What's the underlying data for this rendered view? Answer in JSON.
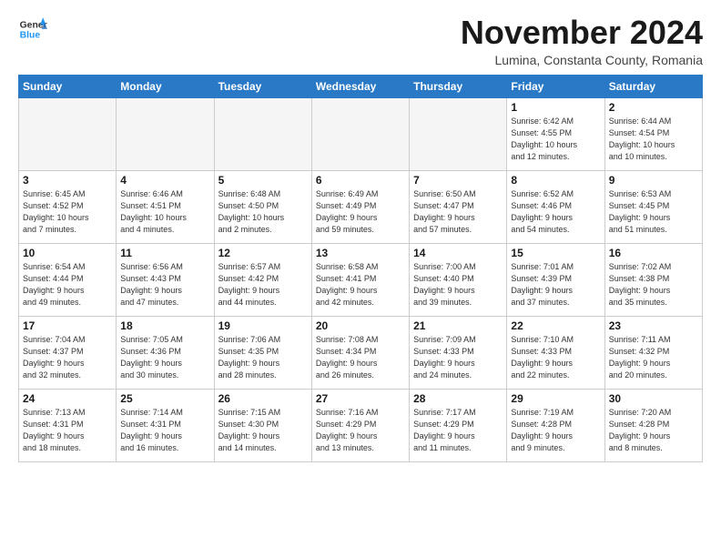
{
  "header": {
    "logo_line1": "General",
    "logo_line2": "Blue",
    "month_title": "November 2024",
    "subtitle": "Lumina, Constanta County, Romania"
  },
  "days_of_week": [
    "Sunday",
    "Monday",
    "Tuesday",
    "Wednesday",
    "Thursday",
    "Friday",
    "Saturday"
  ],
  "weeks": [
    [
      {
        "day": "",
        "info": ""
      },
      {
        "day": "",
        "info": ""
      },
      {
        "day": "",
        "info": ""
      },
      {
        "day": "",
        "info": ""
      },
      {
        "day": "",
        "info": ""
      },
      {
        "day": "1",
        "info": "Sunrise: 6:42 AM\nSunset: 4:55 PM\nDaylight: 10 hours\nand 12 minutes."
      },
      {
        "day": "2",
        "info": "Sunrise: 6:44 AM\nSunset: 4:54 PM\nDaylight: 10 hours\nand 10 minutes."
      }
    ],
    [
      {
        "day": "3",
        "info": "Sunrise: 6:45 AM\nSunset: 4:52 PM\nDaylight: 10 hours\nand 7 minutes."
      },
      {
        "day": "4",
        "info": "Sunrise: 6:46 AM\nSunset: 4:51 PM\nDaylight: 10 hours\nand 4 minutes."
      },
      {
        "day": "5",
        "info": "Sunrise: 6:48 AM\nSunset: 4:50 PM\nDaylight: 10 hours\nand 2 minutes."
      },
      {
        "day": "6",
        "info": "Sunrise: 6:49 AM\nSunset: 4:49 PM\nDaylight: 9 hours\nand 59 minutes."
      },
      {
        "day": "7",
        "info": "Sunrise: 6:50 AM\nSunset: 4:47 PM\nDaylight: 9 hours\nand 57 minutes."
      },
      {
        "day": "8",
        "info": "Sunrise: 6:52 AM\nSunset: 4:46 PM\nDaylight: 9 hours\nand 54 minutes."
      },
      {
        "day": "9",
        "info": "Sunrise: 6:53 AM\nSunset: 4:45 PM\nDaylight: 9 hours\nand 51 minutes."
      }
    ],
    [
      {
        "day": "10",
        "info": "Sunrise: 6:54 AM\nSunset: 4:44 PM\nDaylight: 9 hours\nand 49 minutes."
      },
      {
        "day": "11",
        "info": "Sunrise: 6:56 AM\nSunset: 4:43 PM\nDaylight: 9 hours\nand 47 minutes."
      },
      {
        "day": "12",
        "info": "Sunrise: 6:57 AM\nSunset: 4:42 PM\nDaylight: 9 hours\nand 44 minutes."
      },
      {
        "day": "13",
        "info": "Sunrise: 6:58 AM\nSunset: 4:41 PM\nDaylight: 9 hours\nand 42 minutes."
      },
      {
        "day": "14",
        "info": "Sunrise: 7:00 AM\nSunset: 4:40 PM\nDaylight: 9 hours\nand 39 minutes."
      },
      {
        "day": "15",
        "info": "Sunrise: 7:01 AM\nSunset: 4:39 PM\nDaylight: 9 hours\nand 37 minutes."
      },
      {
        "day": "16",
        "info": "Sunrise: 7:02 AM\nSunset: 4:38 PM\nDaylight: 9 hours\nand 35 minutes."
      }
    ],
    [
      {
        "day": "17",
        "info": "Sunrise: 7:04 AM\nSunset: 4:37 PM\nDaylight: 9 hours\nand 32 minutes."
      },
      {
        "day": "18",
        "info": "Sunrise: 7:05 AM\nSunset: 4:36 PM\nDaylight: 9 hours\nand 30 minutes."
      },
      {
        "day": "19",
        "info": "Sunrise: 7:06 AM\nSunset: 4:35 PM\nDaylight: 9 hours\nand 28 minutes."
      },
      {
        "day": "20",
        "info": "Sunrise: 7:08 AM\nSunset: 4:34 PM\nDaylight: 9 hours\nand 26 minutes."
      },
      {
        "day": "21",
        "info": "Sunrise: 7:09 AM\nSunset: 4:33 PM\nDaylight: 9 hours\nand 24 minutes."
      },
      {
        "day": "22",
        "info": "Sunrise: 7:10 AM\nSunset: 4:33 PM\nDaylight: 9 hours\nand 22 minutes."
      },
      {
        "day": "23",
        "info": "Sunrise: 7:11 AM\nSunset: 4:32 PM\nDaylight: 9 hours\nand 20 minutes."
      }
    ],
    [
      {
        "day": "24",
        "info": "Sunrise: 7:13 AM\nSunset: 4:31 PM\nDaylight: 9 hours\nand 18 minutes."
      },
      {
        "day": "25",
        "info": "Sunrise: 7:14 AM\nSunset: 4:31 PM\nDaylight: 9 hours\nand 16 minutes."
      },
      {
        "day": "26",
        "info": "Sunrise: 7:15 AM\nSunset: 4:30 PM\nDaylight: 9 hours\nand 14 minutes."
      },
      {
        "day": "27",
        "info": "Sunrise: 7:16 AM\nSunset: 4:29 PM\nDaylight: 9 hours\nand 13 minutes."
      },
      {
        "day": "28",
        "info": "Sunrise: 7:17 AM\nSunset: 4:29 PM\nDaylight: 9 hours\nand 11 minutes."
      },
      {
        "day": "29",
        "info": "Sunrise: 7:19 AM\nSunset: 4:28 PM\nDaylight: 9 hours\nand 9 minutes."
      },
      {
        "day": "30",
        "info": "Sunrise: 7:20 AM\nSunset: 4:28 PM\nDaylight: 9 hours\nand 8 minutes."
      }
    ]
  ]
}
